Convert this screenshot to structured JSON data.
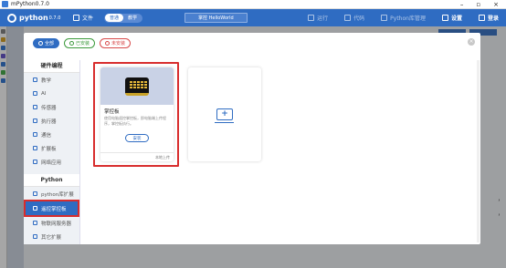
{
  "window": {
    "title": "mPython0.7.0",
    "controls": [
      "–",
      "▫",
      "×"
    ]
  },
  "toolbar": {
    "logo_name": "python",
    "logo_version": "0.7.0",
    "file_label": "文件",
    "mode_normal": "普通",
    "mode_tutorial": "教学",
    "filename": "掌控 HelloWorld",
    "run_label": "运行",
    "code_label": "代码",
    "libmgr_label": "Python库管理",
    "settings_label": "设置",
    "login_label": "登录"
  },
  "workspace": {
    "right_text_1": "，",
    "right_text_2": "，"
  },
  "filters": {
    "all": "全部",
    "installed": "已安装",
    "uninstalled": "未安装"
  },
  "categories": {
    "hardware_head": "硬件编程",
    "hardware_items": [
      "教学",
      "AI",
      "传感器",
      "执行器",
      "通信",
      "扩展板",
      "网络应用"
    ],
    "python_head": "Python",
    "python_items": [
      "python库扩展",
      "遥控掌控板",
      "物联网服务器",
      "其它扩展"
    ],
    "active_index": 1
  },
  "card": {
    "title": "掌控板",
    "description": "使用电脑遥控掌控板，即电脑端上传程序，掌控板执行。",
    "install_label": "安装",
    "footer": "本地上传"
  },
  "colors": {
    "primary": "#2f6cc2",
    "installed": "#3c9a3c",
    "uninstalled": "#d84a4a",
    "highlight": "#d82d2d"
  }
}
